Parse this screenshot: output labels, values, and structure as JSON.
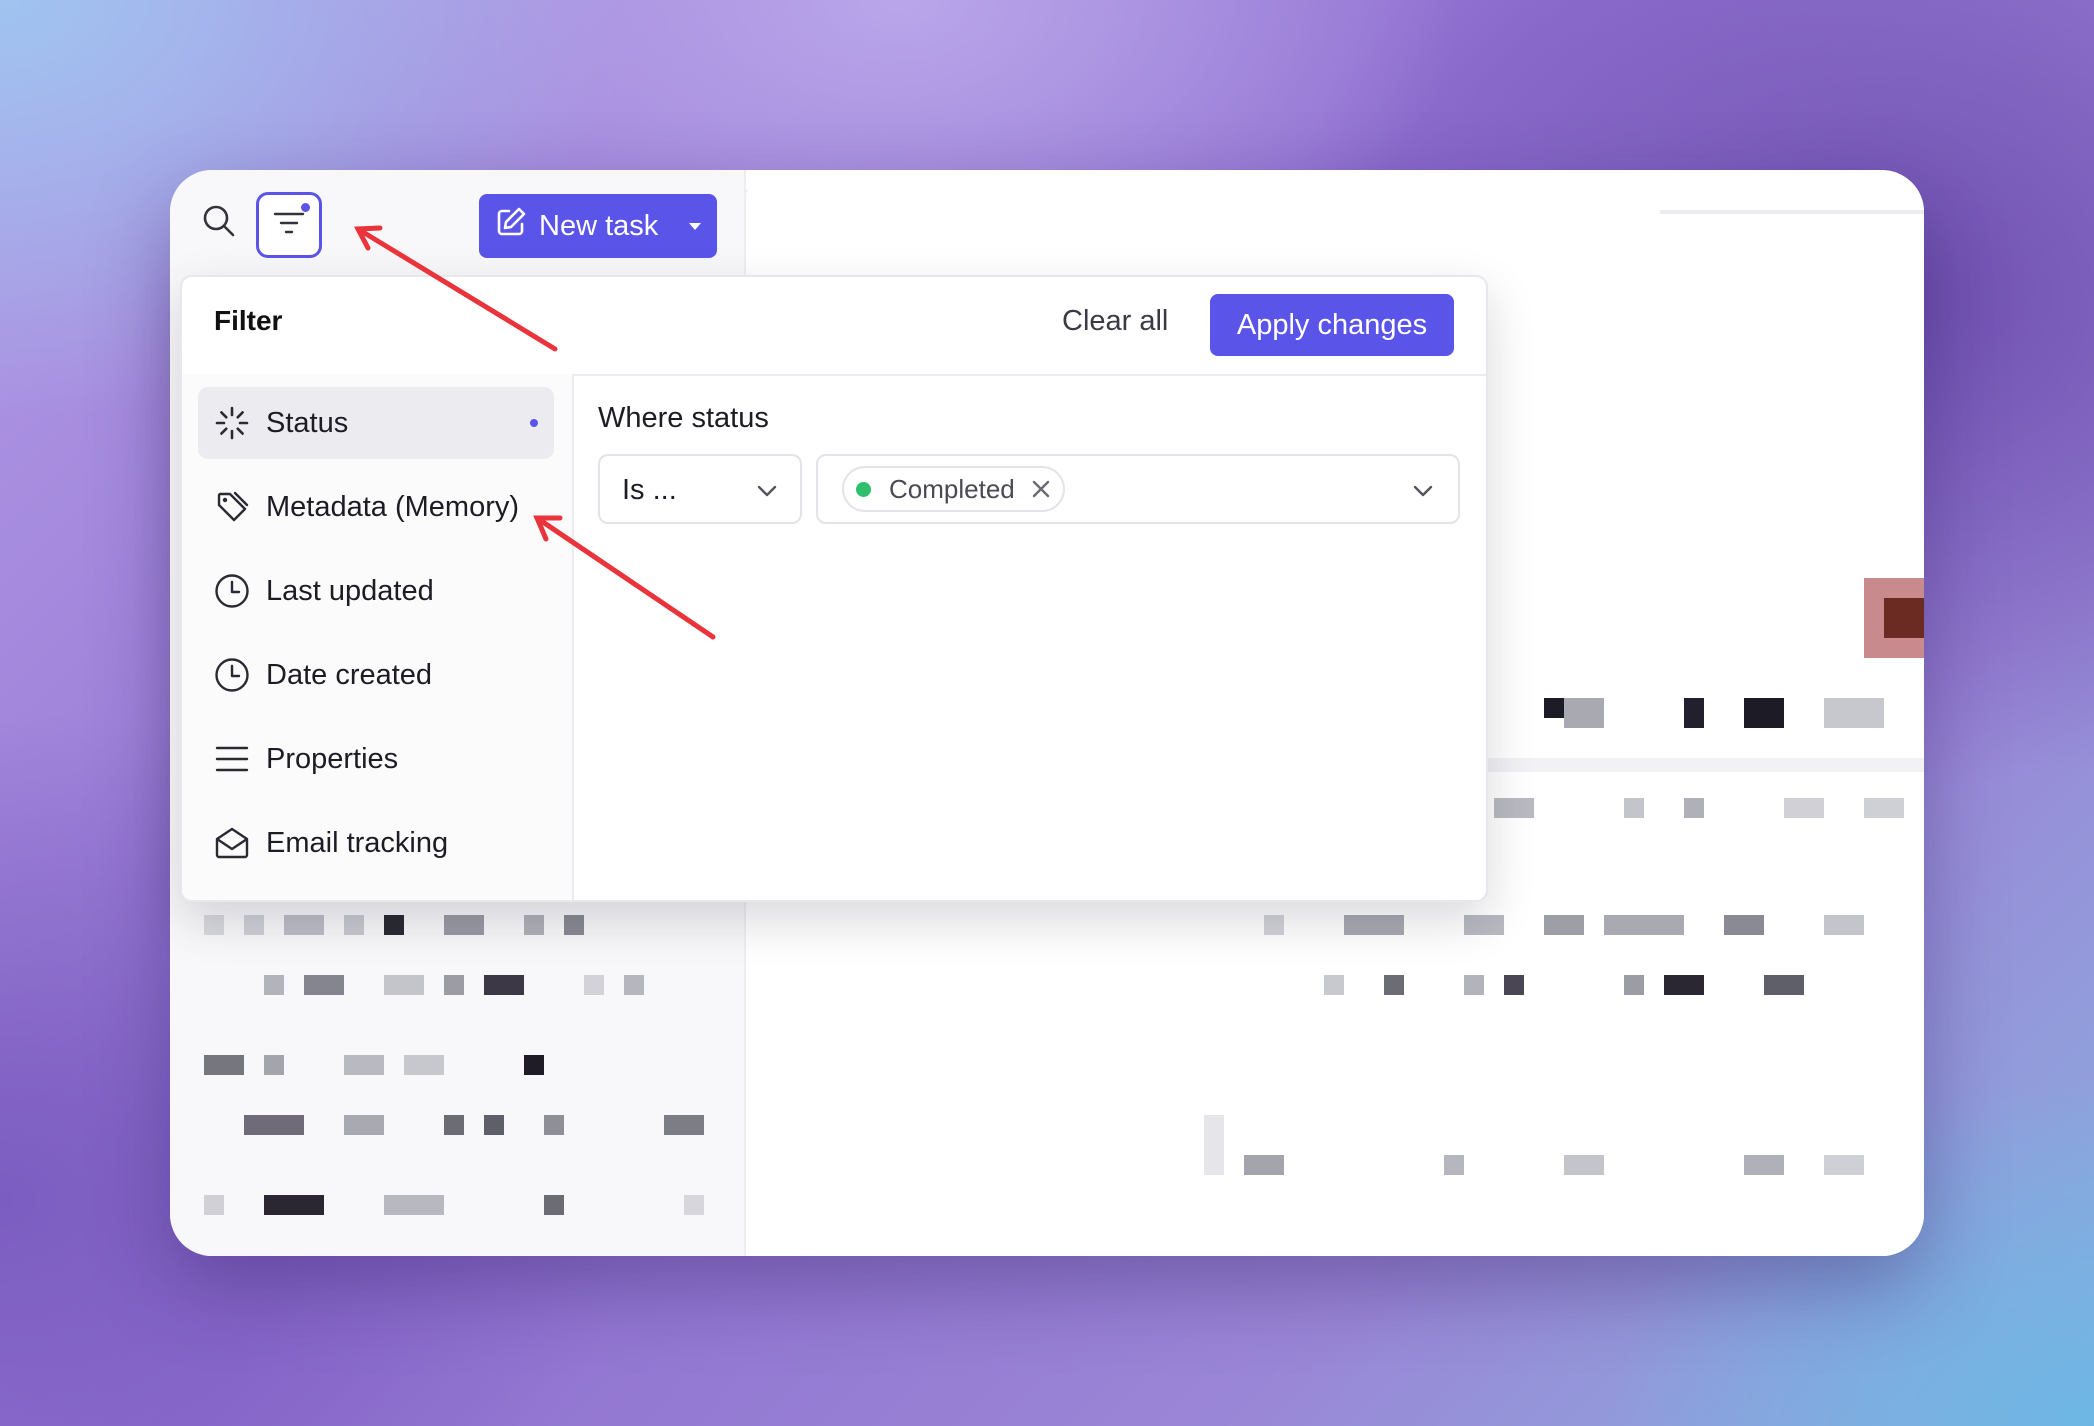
{
  "toolbar": {
    "search_icon": "search-icon",
    "filter_icon": "filter-icon",
    "new_task_label": "New task",
    "new_task_icon": "edit-icon",
    "accent_color": "#5b54e8"
  },
  "filter_panel": {
    "title": "Filter",
    "clear_all_label": "Clear all",
    "apply_label": "Apply changes",
    "categories": [
      {
        "label": "Status",
        "icon": "status-spinner-icon",
        "active": true
      },
      {
        "label": "Metadata (Memory)",
        "icon": "tag-icon",
        "active": false
      },
      {
        "label": "Last updated",
        "icon": "clock-icon",
        "active": false
      },
      {
        "label": "Date created",
        "icon": "clock-icon",
        "active": false
      },
      {
        "label": "Properties",
        "icon": "list-icon",
        "active": false
      },
      {
        "label": "Email tracking",
        "icon": "envelope-open-icon",
        "active": false
      }
    ],
    "condition": {
      "label": "Where status",
      "operator": "Is ...",
      "values": [
        {
          "label": "Completed",
          "status_color": "#2ec06a"
        }
      ]
    }
  },
  "annotations": {
    "arrow_color": "#e8343a"
  }
}
